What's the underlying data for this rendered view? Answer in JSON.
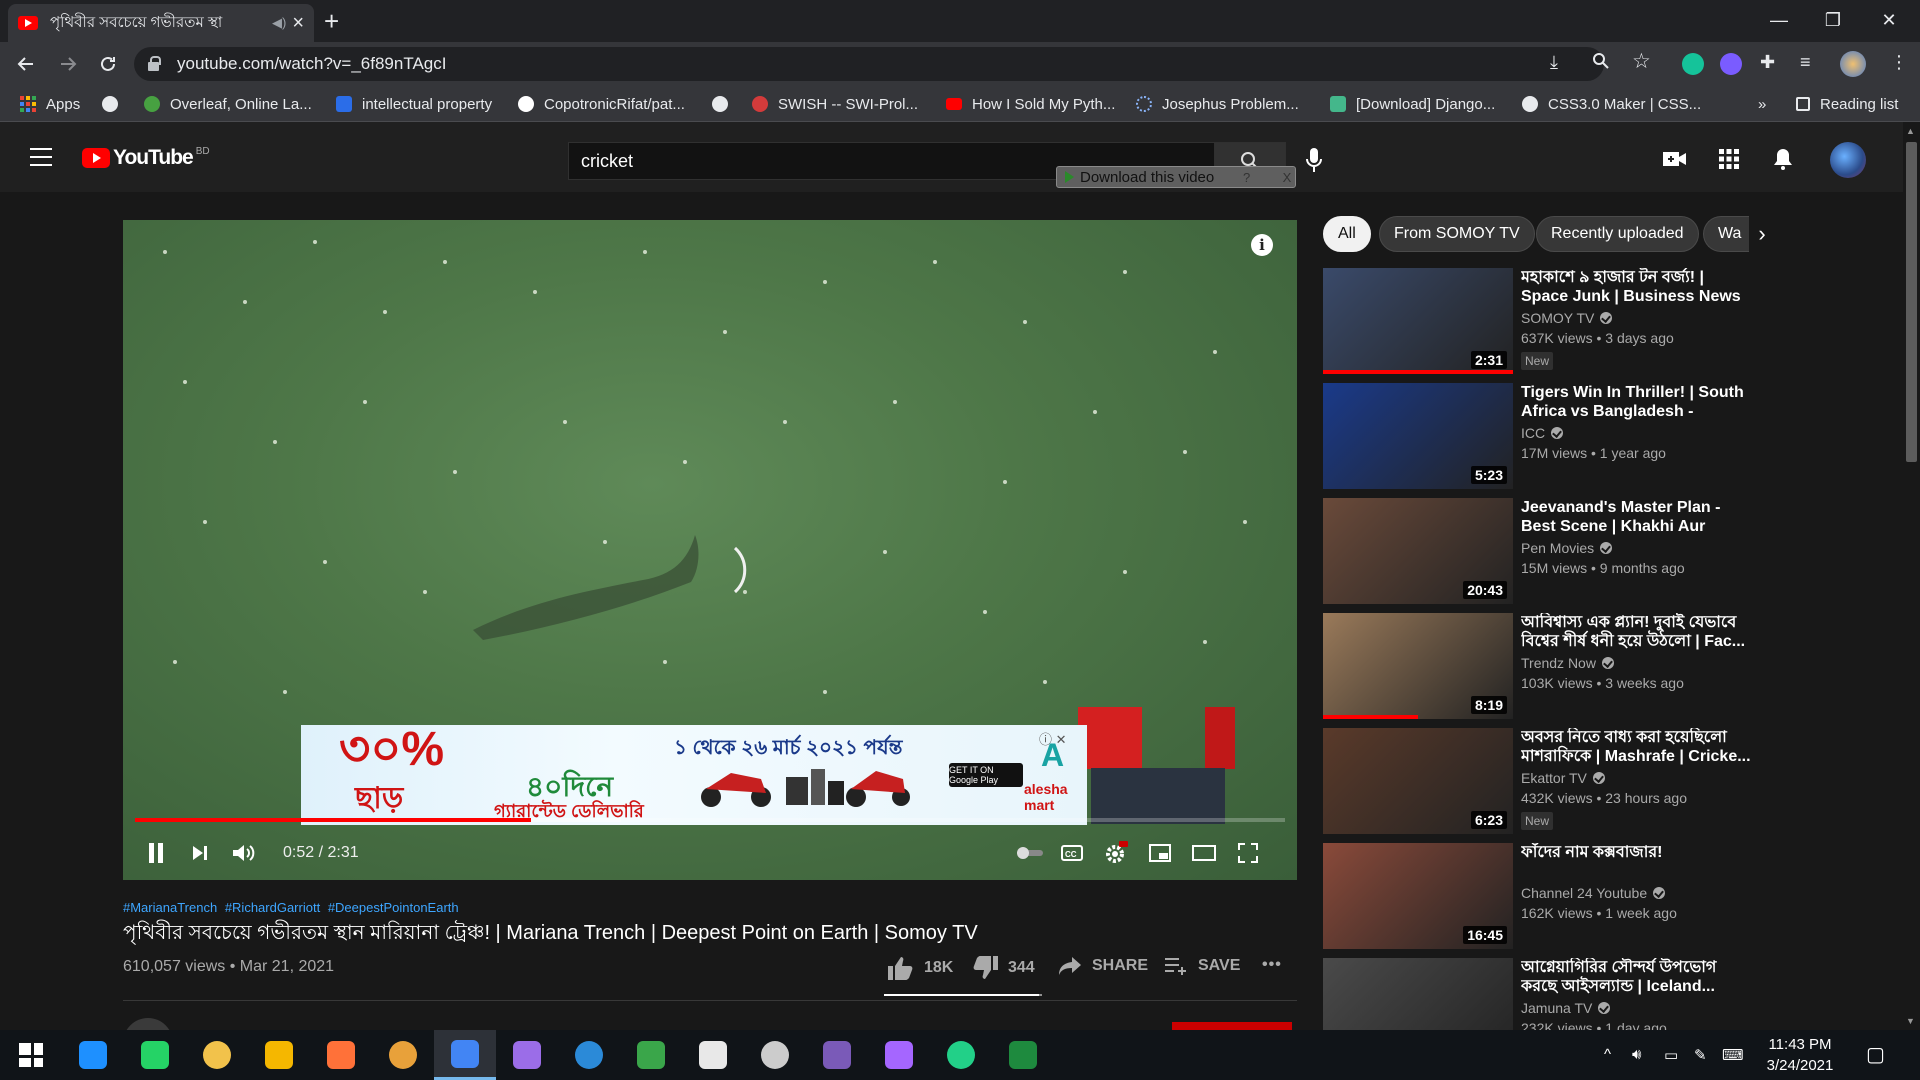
{
  "browser": {
    "tab_title": "পৃথিবীর সবচেয়ে গভীরতম স্থা",
    "tab_audio": "◀)",
    "new_tab": "+",
    "window_controls": {
      "minimize": "—",
      "maximize": "❐",
      "close": "✕"
    },
    "url": "youtube.com/watch?v=_6f89nTAgcI",
    "bookmarks": [
      {
        "label": "Apps",
        "icon": "apps-grid-icon"
      },
      {
        "label": "",
        "icon": "globe-icon"
      },
      {
        "label": "Overleaf, Online La...",
        "icon": "overleaf-icon",
        "color": "#47a141"
      },
      {
        "label": "intellectual property",
        "icon": "s-icon",
        "color": "#2b6de8"
      },
      {
        "label": "CopotronicRifat/pat...",
        "icon": "github-icon",
        "color": "#ffffff"
      },
      {
        "label": "",
        "icon": "globe-icon"
      },
      {
        "label": "SWISH -- SWI-Prol...",
        "icon": "swish-icon",
        "color": "#d33b3b"
      },
      {
        "label": "How I Sold My Pyth...",
        "icon": "youtube-icon",
        "color": "#ff0000"
      },
      {
        "label": "Josephus Problem...",
        "icon": "loading-icon",
        "color": "#8ab4f8"
      },
      {
        "label": "[Download] Django...",
        "icon": "django-icon",
        "color": "#44b78b"
      },
      {
        "label": "CSS3.0 Maker | CSS...",
        "icon": "globe-icon"
      }
    ],
    "bookmarks_overflow": "»",
    "reading_list": "Reading list"
  },
  "youtube": {
    "country_code": "BD",
    "logo_text": "YouTube",
    "search_value": "cricket",
    "download_ext_label": "Download this video",
    "download_ext_help": "?",
    "download_ext_close": "X",
    "chips": [
      "All",
      "From SOMOY TV",
      "Recently uploaded",
      "Wa"
    ],
    "player": {
      "current_time": "0:52",
      "duration": "2:31",
      "time_display": "0:52 / 2:31",
      "played_fraction": 0.344,
      "buffered_fraction": 0.423,
      "ad": {
        "percent": "৩০%",
        "off": "ছাড়",
        "dates": "১ থেকে ২৬ মার্চ ২০২১ পর্যন্ত",
        "delivery_days": "৪০দিনে",
        "delivery": "গ্যারান্টেড ডেলিভারি",
        "store": "GET IT ON Google Play",
        "brand": "alesha mart",
        "close": "ⓘ ✕"
      }
    },
    "video": {
      "hashtags": [
        "#MarianaTrench",
        "#RichardGarriott",
        "#DeepestPointonEarth"
      ],
      "title": "পৃথিবীর সবচেয়ে গভীরতম স্থান মারিয়ানা ট্রেঞ্চ! | Mariana Trench | Deepest Point on Earth | Somoy TV",
      "meta": "610,057 views • Mar 21, 2021",
      "likes": "18K",
      "dislikes": "344",
      "like_fraction": 0.981,
      "share": "SHARE",
      "save": "SAVE",
      "more": "•••"
    },
    "recommendations": [
      {
        "title": "মহাকাশে ৯ হাজার টন বর্জ্য! | Space Junk | Business News |...",
        "channel": "SOMOY TV",
        "views": "637K views • 3 days ago",
        "duration": "2:31",
        "badge": "New",
        "watched_fraction": 1.0,
        "bg": "#3a4a6a"
      },
      {
        "title": "Tigers Win In Thriller! | South Africa vs Bangladesh - Match...",
        "channel": "ICC",
        "views": "17M views • 1 year ago",
        "duration": "5:23",
        "badge": "",
        "watched_fraction": 0,
        "bg": "#1a3a8a"
      },
      {
        "title": "Jeevanand's Master Plan - Best Scene | Khakhi Aur Khiladi |...",
        "channel": "Pen Movies",
        "views": "15M views • 9 months ago",
        "duration": "20:43",
        "badge": "",
        "watched_fraction": 0,
        "bg": "#6a4a3a"
      },
      {
        "title": "আবিশ্বাস্য এক প্ল্যান! দুবাই যেভাবে বিশ্বের শীর্ষ ধনী হয়ে উঠলো | Fac...",
        "channel": "Trendz Now",
        "views": "103K views • 3 weeks ago",
        "duration": "8:19",
        "badge": "",
        "watched_fraction": 0.5,
        "bg": "#9a7a5a"
      },
      {
        "title": "অবসর নিতে বাধ্য করা হয়েছিলো মাশরাফিকে | Mashrafe | Cricke...",
        "channel": "Ekattor TV",
        "views": "432K views • 23 hours ago",
        "duration": "6:23",
        "badge": "New",
        "watched_fraction": 0,
        "bg": "#5a3a2a"
      },
      {
        "title": "ফাঁদের নাম কক্সবাজার!",
        "channel": "Channel 24 Youtube",
        "views": "162K views • 1 week ago",
        "duration": "16:45",
        "badge": "",
        "watched_fraction": 0,
        "bg": "#8a4a3a"
      },
      {
        "title": "আগ্নেয়াগিরির সৌন্দর্য উপভোগ করছে আইসল্যান্ড | Iceland...",
        "channel": "Jamuna TV",
        "views": "232K views • 1 day ago",
        "duration": "",
        "badge": "",
        "watched_fraction": 0,
        "bg": "#4a4a4a"
      }
    ]
  },
  "taskbar": {
    "apps": [
      "windows-start-icon",
      "edge-icon",
      "whatsapp-icon",
      "file-explorer-icon",
      "tor-icon",
      "firefox-icon",
      "lightshot-icon",
      "chrome-icon",
      "github-desktop-icon",
      "vscode-icon",
      "maps-icon",
      "ghost-icon",
      "bot-icon",
      "visual-studio-icon",
      "messenger-icon",
      "pycharm-icon",
      "excel-icon"
    ],
    "time": "11:43 PM",
    "date": "3/24/2021"
  },
  "colors": {
    "accent_red": "#ff0000",
    "link_blue": "#3ea6ff",
    "yt_bg": "#181818",
    "chrome_bg": "#35363a"
  }
}
